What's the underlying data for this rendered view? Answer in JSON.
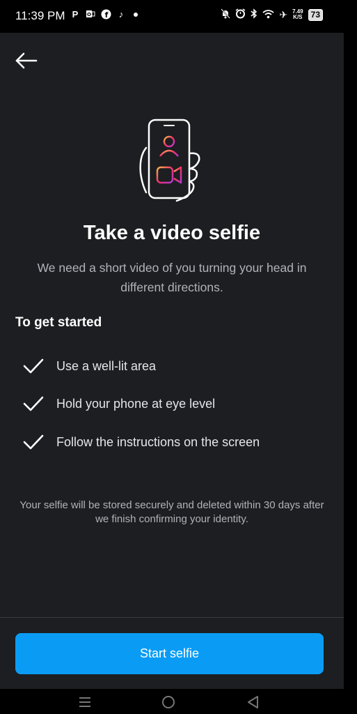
{
  "status_bar": {
    "time": "11:39 PM",
    "left_icons": [
      "p-icon",
      "outlook-icon",
      "facebook-icon",
      "tiktok-icon",
      "dot-icon"
    ],
    "right_icons": [
      "mute-bell-icon",
      "alarm-icon",
      "bluetooth-icon",
      "wifi-icon",
      "airplane-icon"
    ],
    "net_speed_value": "7.49",
    "net_speed_unit": "K/S",
    "battery": "73"
  },
  "header": {
    "back_icon": "arrow-left-icon"
  },
  "main": {
    "illustration": "phone-selfie-icon",
    "title": "Take a video selfie",
    "subtitle": "We need a short video of you turning your head in different directions.",
    "section_heading": "To get started",
    "checklist": [
      "Use a well-lit area",
      "Hold your phone at eye level",
      "Follow the instructions on the screen"
    ],
    "footnote": "Your selfie will be stored securely and deleted within 30 days after we finish confirming your identity."
  },
  "footer": {
    "start_label": "Start selfie"
  },
  "nav_bar": {
    "buttons": [
      "menu-icon",
      "home-icon",
      "back-triangle-icon"
    ]
  },
  "colors": {
    "background": "#1c1e21",
    "accent": "#0a9cf5",
    "secondary_text": "#b0b3b8"
  }
}
